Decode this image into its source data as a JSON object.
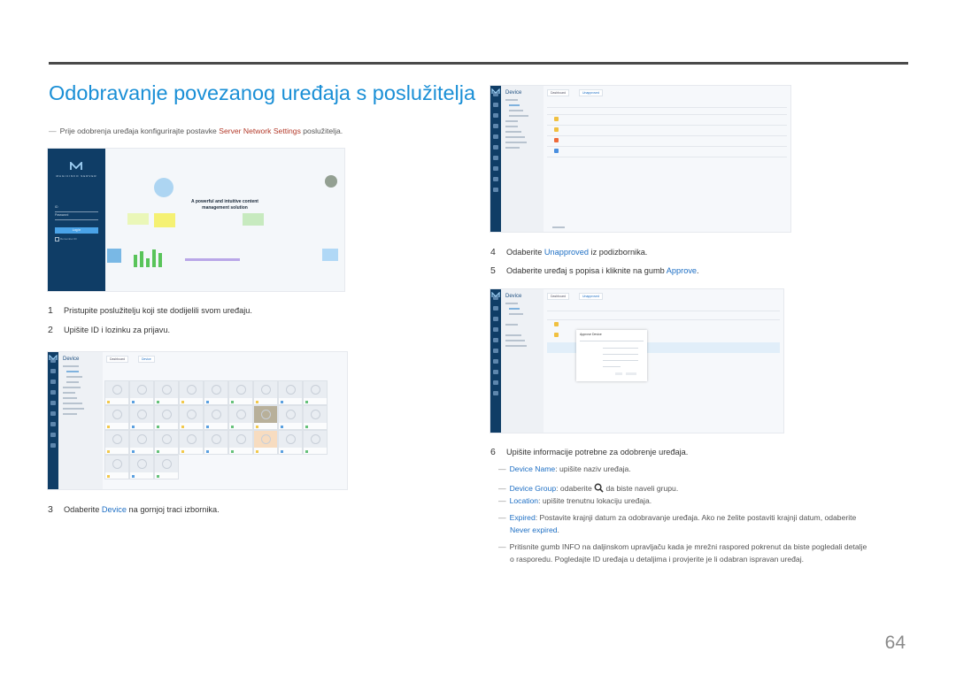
{
  "title": "Odobravanje povezanog uređaja s poslužitelja",
  "prereq_note": {
    "dash": "―",
    "before": "Prije odobrenja uređaja konfigurirajte postavke ",
    "link": "Server Network Settings",
    "after": " poslužitelja."
  },
  "login_screen": {
    "brand": "MAGICINFO SERVER",
    "id_label": "ID",
    "password_label": "Password",
    "login_button": "Log in",
    "remember_label": "Remember ID",
    "headline_line1": "A powerful and intuitive content",
    "headline_line2": "management solution"
  },
  "device_screen": {
    "menu_title": "Device",
    "home_tab": "Dashboard",
    "device_tab": "Device",
    "unapproved_tab": "Unapproved",
    "menu_items": [
      "All",
      "Unapproved",
      "Connected",
      "Disconnected",
      "Warning",
      "Error",
      "Device Tag",
      "Software Update",
      "Device Health"
    ],
    "popup_title": "Approve Device"
  },
  "steps": [
    {
      "num": "1",
      "text": "Pristupite poslužitelju koji ste dodijelili svom uređaju."
    },
    {
      "num": "2",
      "text": "Upišite ID i lozinku za prijavu."
    },
    {
      "num": "3",
      "before": "Odaberite ",
      "link": "Device",
      "after": " na gornjoj traci izbornika."
    },
    {
      "num": "4",
      "before": "Odaberite ",
      "link": "Unapproved",
      "after": " iz podizbornika."
    },
    {
      "num": "5",
      "before": "Odaberite uređaj s popisa i kliknite na gumb ",
      "link": "Approve",
      "after": "."
    },
    {
      "num": "6",
      "text": "Upišite informacije potrebne za odobrenje uređaja."
    }
  ],
  "sub_notes": {
    "device_name": {
      "link": "Device Name",
      "text": ": upišite naziv uređaja."
    },
    "device_group": {
      "link": "Device Group",
      "before": ": odaberite ",
      "after": " da biste naveli grupu.",
      "icon": "search-icon"
    },
    "location": {
      "link": "Location",
      "text": ": upišite trenutnu lokaciju uređaja."
    },
    "expired": {
      "link": "Expired",
      "text": ": Postavite krajnji datum za odobravanje uređaja. Ako ne želite postaviti krajnji datum, odaberite",
      "link2": "Never expired",
      "end": "."
    },
    "info": {
      "line1": "Pritisnite gumb INFO na daljinskom upravljaču kada je mrežni raspored pokrenut da biste pogledali detalje",
      "line2": "o rasporedu. Pogledajte ID uređaja u detaljima i provjerite je li odabran ispravan uređaj."
    }
  },
  "page_number": "64",
  "colors": {
    "accent": "#1a8fd6",
    "link": "#1e6fc4",
    "highlight": "#b33a2a",
    "sidebar": "#0f3d66"
  }
}
